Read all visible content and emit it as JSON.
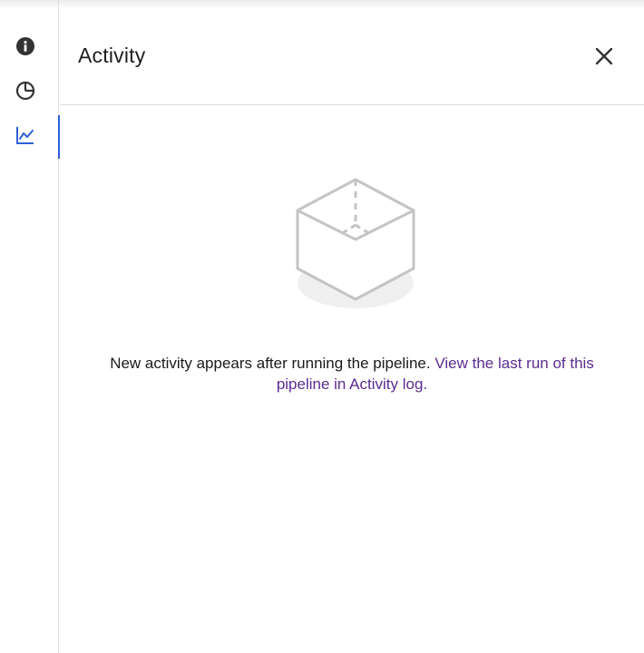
{
  "rail": {
    "items": [
      {
        "icon": "info-icon",
        "active": false
      },
      {
        "icon": "pie-chart-icon",
        "active": false
      },
      {
        "icon": "line-chart-icon",
        "active": true
      }
    ],
    "active_color": "#2f5fd6",
    "icon_color": "#333333"
  },
  "panel": {
    "title": "Activity",
    "close_icon": "close-icon"
  },
  "empty_state": {
    "illustration": "empty-box-icon",
    "message": "New activity appears after running the pipeline.",
    "link_text": "View the last run of this pipeline in Activity log.",
    "link_color": "#5b2c8f"
  }
}
